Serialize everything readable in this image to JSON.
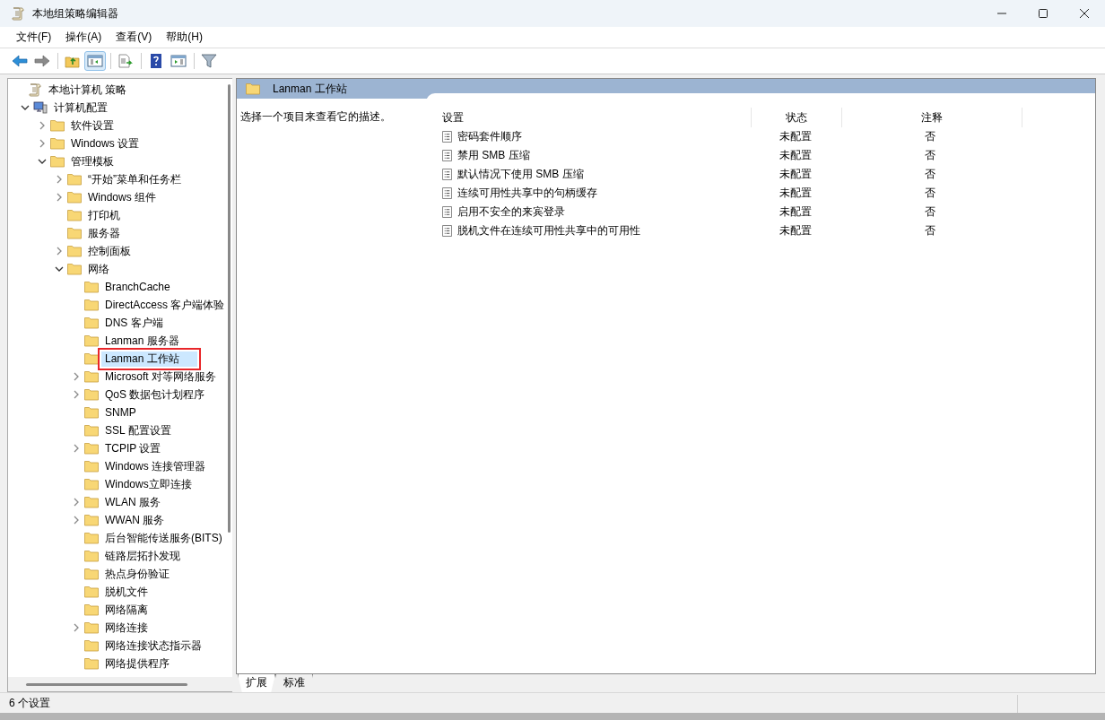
{
  "window": {
    "title": "本地组策略编辑器"
  },
  "menu": [
    "文件(F)",
    "操作(A)",
    "查看(V)",
    "帮助(H)"
  ],
  "toolbar": [
    {
      "kind": "back",
      "disabled": false,
      "pressed": false
    },
    {
      "kind": "forward",
      "disabled": true,
      "pressed": false
    },
    {
      "kind": "up",
      "disabled": false,
      "pressed": false
    },
    {
      "kind": "tree",
      "disabled": false,
      "pressed": true
    },
    {
      "kind": "export",
      "disabled": false,
      "pressed": false
    },
    {
      "kind": "help",
      "disabled": false,
      "pressed": false
    },
    {
      "kind": "view",
      "disabled": false,
      "pressed": false
    },
    {
      "kind": "filter",
      "disabled": false,
      "pressed": false
    }
  ],
  "tree": [
    {
      "label": "本地计算机 策略",
      "kind": "policy",
      "selected": false,
      "children": [
        {
          "label": "计算机配置",
          "kind": "computer",
          "expanded": true,
          "selected": false,
          "children": [
            {
              "label": "软件设置",
              "kind": "folder",
              "expanded": false,
              "selected": false
            },
            {
              "label": "Windows 设置",
              "kind": "folder",
              "expanded": false,
              "selected": false
            },
            {
              "label": "管理模板",
              "kind": "folder",
              "expanded": true,
              "selected": false,
              "children": [
                {
                  "label": "“开始”菜单和任务栏",
                  "kind": "folder",
                  "expanded": false,
                  "selected": false
                },
                {
                  "label": "Windows 组件",
                  "kind": "folder",
                  "expanded": false,
                  "selected": false
                },
                {
                  "label": "打印机",
                  "kind": "folder",
                  "selected": false
                },
                {
                  "label": "服务器",
                  "kind": "folder",
                  "selected": false
                },
                {
                  "label": "控制面板",
                  "kind": "folder",
                  "expanded": false,
                  "selected": false
                },
                {
                  "label": "网络",
                  "kind": "folder",
                  "expanded": true,
                  "selected": false,
                  "children": [
                    {
                      "label": "BranchCache",
                      "kind": "folder",
                      "selected": false
                    },
                    {
                      "label": "DirectAccess 客户端体验",
                      "kind": "folder",
                      "selected": false
                    },
                    {
                      "label": "DNS 客户端",
                      "kind": "folder",
                      "selected": false
                    },
                    {
                      "label": "Lanman 服务器",
                      "kind": "folder",
                      "selected": false
                    },
                    {
                      "label": "Lanman 工作站",
                      "kind": "folder",
                      "selected": true,
                      "marked": true
                    },
                    {
                      "label": "Microsoft 对等网络服务",
                      "kind": "folder",
                      "expanded": false,
                      "selected": false
                    },
                    {
                      "label": "QoS 数据包计划程序",
                      "kind": "folder",
                      "expanded": false,
                      "selected": false
                    },
                    {
                      "label": "SNMP",
                      "kind": "folder",
                      "selected": false
                    },
                    {
                      "label": "SSL 配置设置",
                      "kind": "folder",
                      "selected": false
                    },
                    {
                      "label": "TCPIP 设置",
                      "kind": "folder",
                      "expanded": false,
                      "selected": false
                    },
                    {
                      "label": "Windows 连接管理器",
                      "kind": "folder",
                      "selected": false
                    },
                    {
                      "label": "Windows立即连接",
                      "kind": "folder",
                      "selected": false
                    },
                    {
                      "label": "WLAN 服务",
                      "kind": "folder",
                      "expanded": false,
                      "selected": false
                    },
                    {
                      "label": "WWAN 服务",
                      "kind": "folder",
                      "expanded": false,
                      "selected": false
                    },
                    {
                      "label": "后台智能传送服务(BITS)",
                      "kind": "folder",
                      "selected": false
                    },
                    {
                      "label": "链路层拓扑发现",
                      "kind": "folder",
                      "selected": false
                    },
                    {
                      "label": "热点身份验证",
                      "kind": "folder",
                      "selected": false
                    },
                    {
                      "label": "脱机文件",
                      "kind": "folder",
                      "selected": false
                    },
                    {
                      "label": "网络隔离",
                      "kind": "folder",
                      "selected": false
                    },
                    {
                      "label": "网络连接",
                      "kind": "folder",
                      "expanded": false,
                      "selected": false
                    },
                    {
                      "label": "网络连接状态指示器",
                      "kind": "folder",
                      "selected": false
                    },
                    {
                      "label": "网络提供程序",
                      "kind": "folder",
                      "selected": false
                    }
                  ]
                }
              ]
            }
          ]
        }
      ]
    }
  ],
  "details": {
    "title": "Lanman 工作站",
    "description": "选择一个项目来查看它的描述。",
    "columns": [
      "设置",
      "状态",
      "注释"
    ],
    "rows": [
      {
        "name": "密码套件顺序",
        "state": "未配置",
        "comment": "否"
      },
      {
        "name": "禁用 SMB 压缩",
        "state": "未配置",
        "comment": "否"
      },
      {
        "name": "默认情况下使用 SMB 压缩",
        "state": "未配置",
        "comment": "否"
      },
      {
        "name": "连续可用性共享中的句柄缓存",
        "state": "未配置",
        "comment": "否"
      },
      {
        "name": "启用不安全的来宾登录",
        "state": "未配置",
        "comment": "否"
      },
      {
        "name": "脱机文件在连续可用性共享中的可用性",
        "state": "未配置",
        "comment": "否"
      }
    ]
  },
  "view_tabs": [
    {
      "label": "扩展",
      "selected": true
    },
    {
      "label": "标准",
      "selected": false
    }
  ],
  "status_bar": "6 个设置"
}
